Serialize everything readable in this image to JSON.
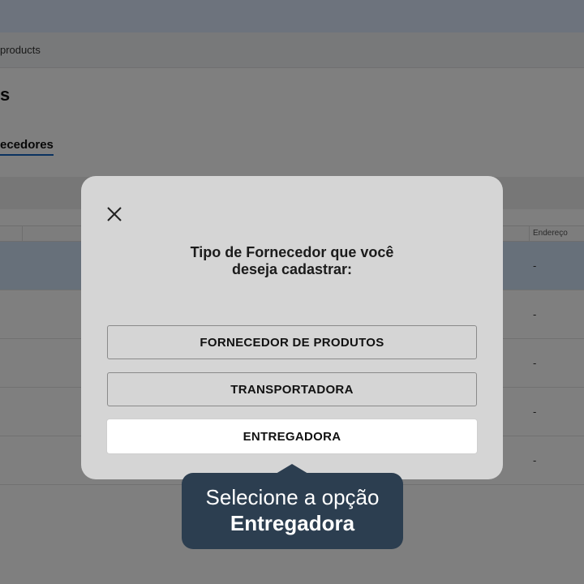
{
  "browser": {
    "address_text": "products"
  },
  "page": {
    "title": "s",
    "tab_label": "ecedores",
    "table": {
      "columns": [
        "Endereço"
      ],
      "rows": [
        "-",
        "-",
        "-",
        "-",
        "-"
      ]
    }
  },
  "modal": {
    "title_line1": "Tipo de Fornecedor que você",
    "title_line2": "deseja cadastrar:",
    "options": [
      "FORNECEDOR DE PRODUTOS",
      "TRANSPORTADORA",
      "ENTREGADORA"
    ],
    "highlighted_option": "ENTREGADORA"
  },
  "tooltip": {
    "line1": "Selecione a opção",
    "line2": "Entregadora"
  },
  "colors": {
    "overlay": "#000000",
    "modal_bg": "#d5d5d5",
    "tooltip_bg": "#2c3e50",
    "tab_underline": "#1565c0",
    "selected_row": "#cfe0f5"
  }
}
